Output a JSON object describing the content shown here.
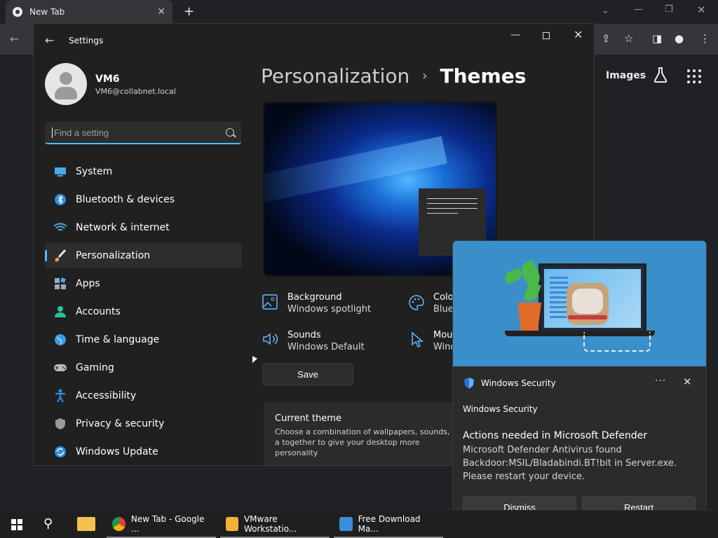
{
  "chrome": {
    "tab_title": "New Tab",
    "google_images_link": "Images"
  },
  "settings": {
    "window_title": "Settings",
    "user": {
      "name": "VM6",
      "email": "VM6@collabnet.local"
    },
    "search_placeholder": "Find a setting",
    "nav": [
      {
        "label": "System",
        "icon": "system-icon"
      },
      {
        "label": "Bluetooth & devices",
        "icon": "bluetooth-icon"
      },
      {
        "label": "Network & internet",
        "icon": "network-icon"
      },
      {
        "label": "Personalization",
        "icon": "brush-icon",
        "active": true
      },
      {
        "label": "Apps",
        "icon": "apps-icon"
      },
      {
        "label": "Accounts",
        "icon": "accounts-icon"
      },
      {
        "label": "Time & language",
        "icon": "globe-icon"
      },
      {
        "label": "Gaming",
        "icon": "gamepad-icon"
      },
      {
        "label": "Accessibility",
        "icon": "accessibility-icon"
      },
      {
        "label": "Privacy & security",
        "icon": "shield-icon"
      },
      {
        "label": "Windows Update",
        "icon": "update-icon"
      }
    ],
    "breadcrumb_parent": "Personalization",
    "breadcrumb_separator": "›",
    "breadcrumb_current": "Themes",
    "options": {
      "background": {
        "title": "Background",
        "value": "Windows spotlight"
      },
      "color": {
        "title": "Colo",
        "value": "Blue"
      },
      "sounds": {
        "title": "Sounds",
        "value": "Windows Default"
      },
      "mouse": {
        "title": "Mou",
        "value": "Wind"
      }
    },
    "save_label": "Save",
    "current_theme": {
      "title": "Current theme",
      "description": "Choose a combination of wallpapers, sounds, a together to give your desktop more personality"
    }
  },
  "toast": {
    "app_name": "Windows Security",
    "more_label": "···",
    "source": "Windows Security",
    "heading": "Actions needed in Microsoft Defender",
    "body": "Microsoft Defender Antivirus found Backdoor:MSIL/Bladabindi.BT!bit in Server.exe. Please restart your device.",
    "dismiss_label": "Dismiss",
    "restart_label": "Restart"
  },
  "taskbar": {
    "apps": [
      {
        "label": "New Tab - Google ...",
        "color": "#db4437"
      },
      {
        "label": "VMware Workstatio...",
        "color": "#f2b134"
      },
      {
        "label": "Free Download Ma...",
        "color": "#3a8fd8"
      }
    ]
  },
  "colors": {
    "accent": "#4cc2ff",
    "toast_hero": "#3a8fcb"
  }
}
